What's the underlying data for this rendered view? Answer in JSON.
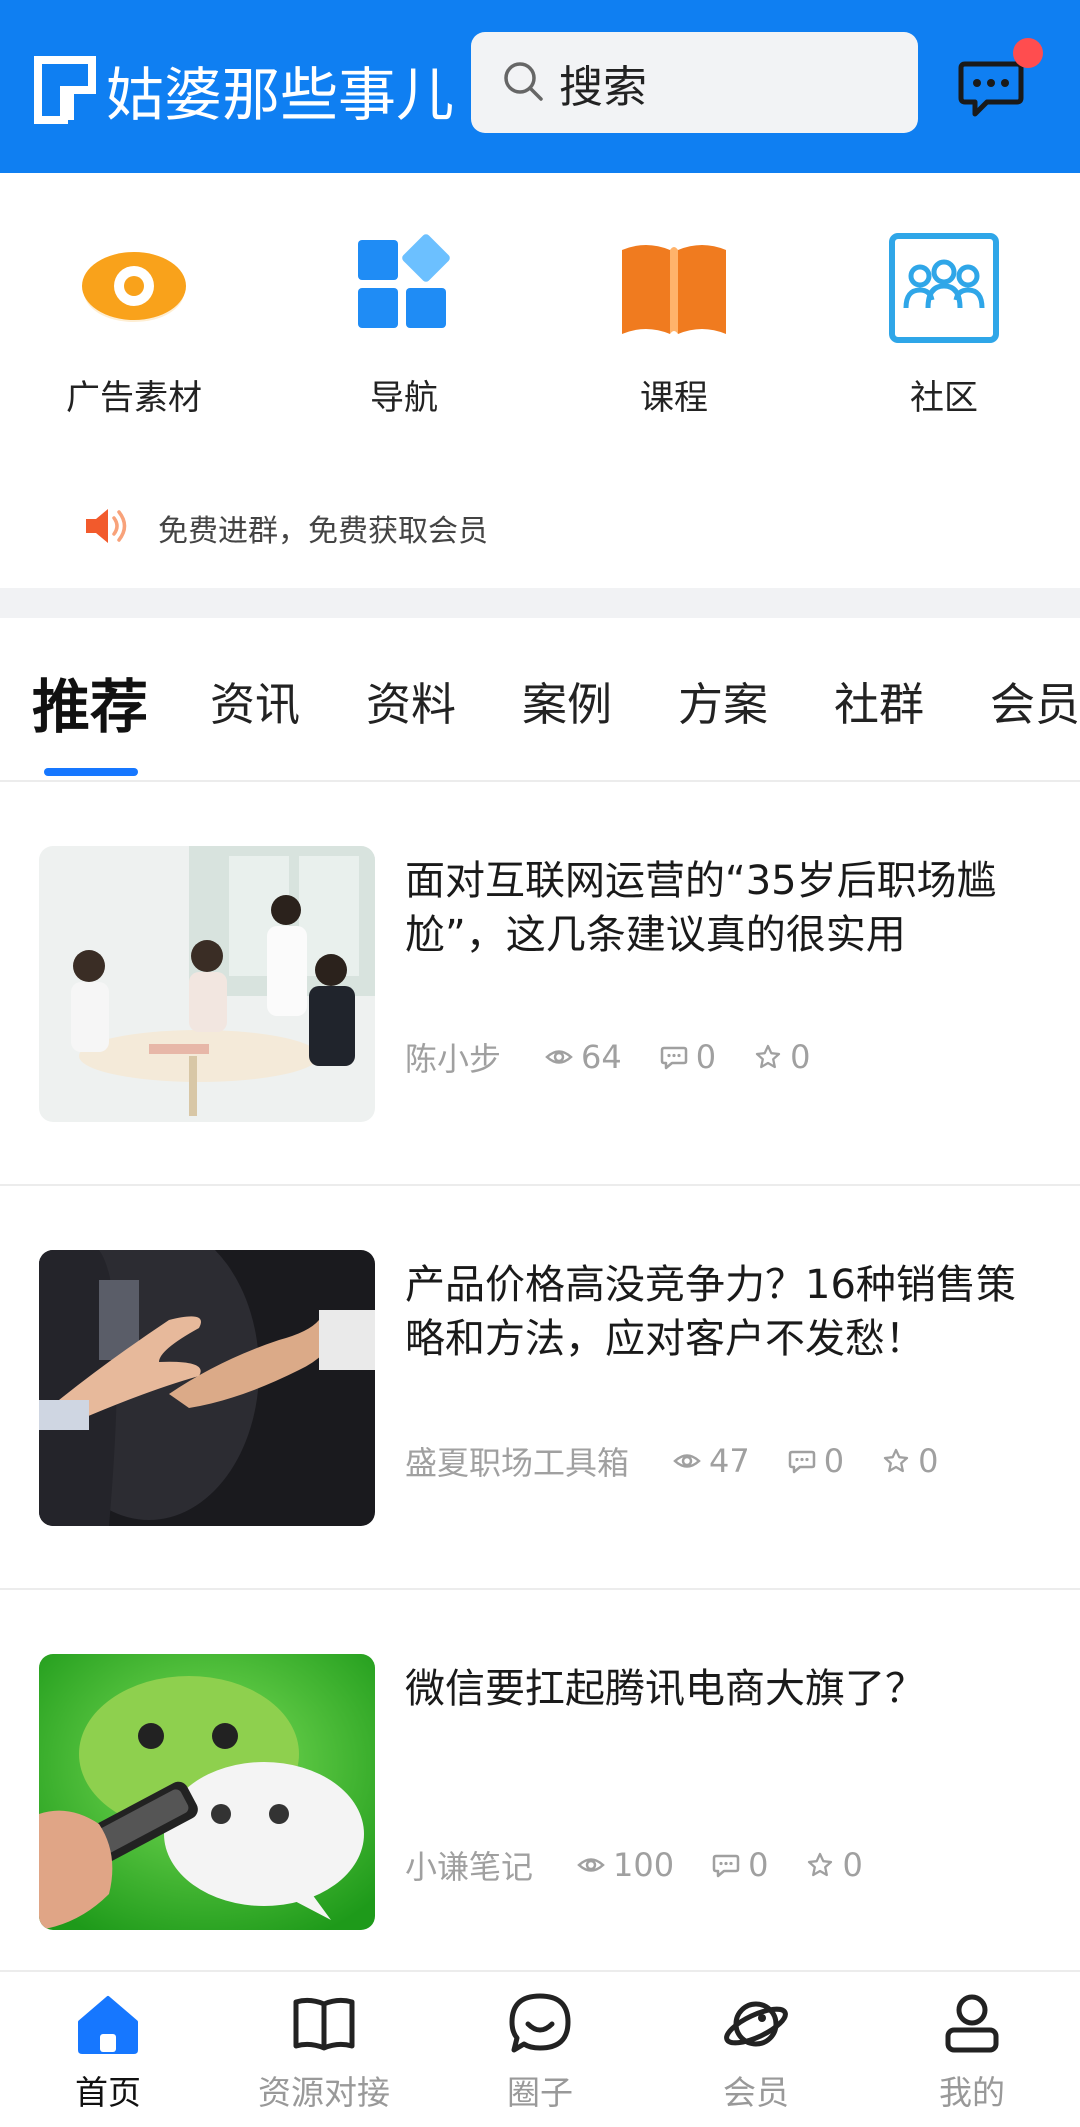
{
  "header": {
    "logo_text": "姑婆那些事儿",
    "search_placeholder": "搜索",
    "messages_has_unread": true,
    "brand_color": "#0f7ff2"
  },
  "quick_links": [
    {
      "label": "广告素材",
      "icon": "eye-icon",
      "color": "#f7a21b"
    },
    {
      "label": "导航",
      "icon": "grid-apps-icon",
      "color": "#1f8cf5"
    },
    {
      "label": "课程",
      "icon": "open-book-icon",
      "color": "#f07b1f"
    },
    {
      "label": "社区",
      "icon": "community-people-icon",
      "color": "#2fa6e8"
    }
  ],
  "notice": {
    "icon": "speaker-icon",
    "text": "免费进群，免费获取会员"
  },
  "tabs": {
    "items": [
      "推荐",
      "资讯",
      "资料",
      "案例",
      "方案",
      "社群",
      "会员"
    ],
    "active": "推荐",
    "accent": "#1677ff"
  },
  "articles": [
    {
      "title": "面对互联网运营的“35岁后职场尴尬”，这几条建议真的很实用",
      "author": "陈小步",
      "views": "64",
      "comments": "0",
      "favorites": "0"
    },
    {
      "title": "产品价格高没竞争力？16种销售策略和方法，应对客户不发愁！",
      "author": "盛夏职场工具箱",
      "views": "47",
      "comments": "0",
      "favorites": "0"
    },
    {
      "title": "微信要扛起腾讯电商大旗了？",
      "author": "小谦笔记",
      "views": "100",
      "comments": "0",
      "favorites": "0"
    }
  ],
  "bottom_nav": {
    "items": [
      {
        "label": "首页",
        "icon": "home-icon"
      },
      {
        "label": "资源对接",
        "icon": "book-icon"
      },
      {
        "label": "圈子",
        "icon": "chat-smile-icon"
      },
      {
        "label": "会员",
        "icon": "planet-icon"
      },
      {
        "label": "我的",
        "icon": "user-icon"
      }
    ],
    "active": "首页"
  }
}
